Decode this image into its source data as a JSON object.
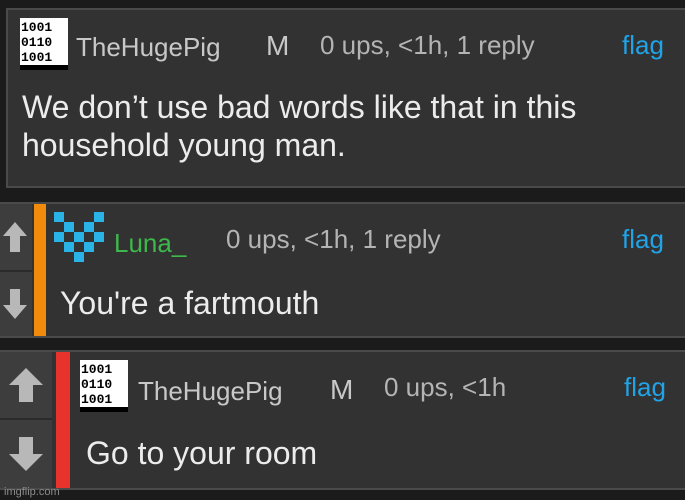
{
  "comments": [
    {
      "username": "TheHugePig",
      "badge": "M",
      "meta": "0 ups, <1h, 1 reply",
      "flag": "flag",
      "body_line1": "We don’t use bad words like that in this",
      "body_line2": "household young man.",
      "avatar": "binary-grid-avatar"
    },
    {
      "username": "Luna_",
      "meta": "0 ups, <1h, 1 reply",
      "flag": "flag",
      "body_line1": "You're a fartmouth",
      "avatar": "blue-pixel-avatar",
      "accent_color": "#f28a0c",
      "username_color": "#3db84a"
    },
    {
      "username": "TheHugePig",
      "badge": "M",
      "meta": "0 ups, <1h",
      "flag": "flag",
      "body_line1": "Go to your room",
      "avatar": "binary-grid-avatar",
      "accent_color": "#e8322c"
    }
  ],
  "watermark": "imgflip.com",
  "colors": {
    "link": "#21a3e8",
    "panel": "#323232",
    "text": "#ececec"
  }
}
